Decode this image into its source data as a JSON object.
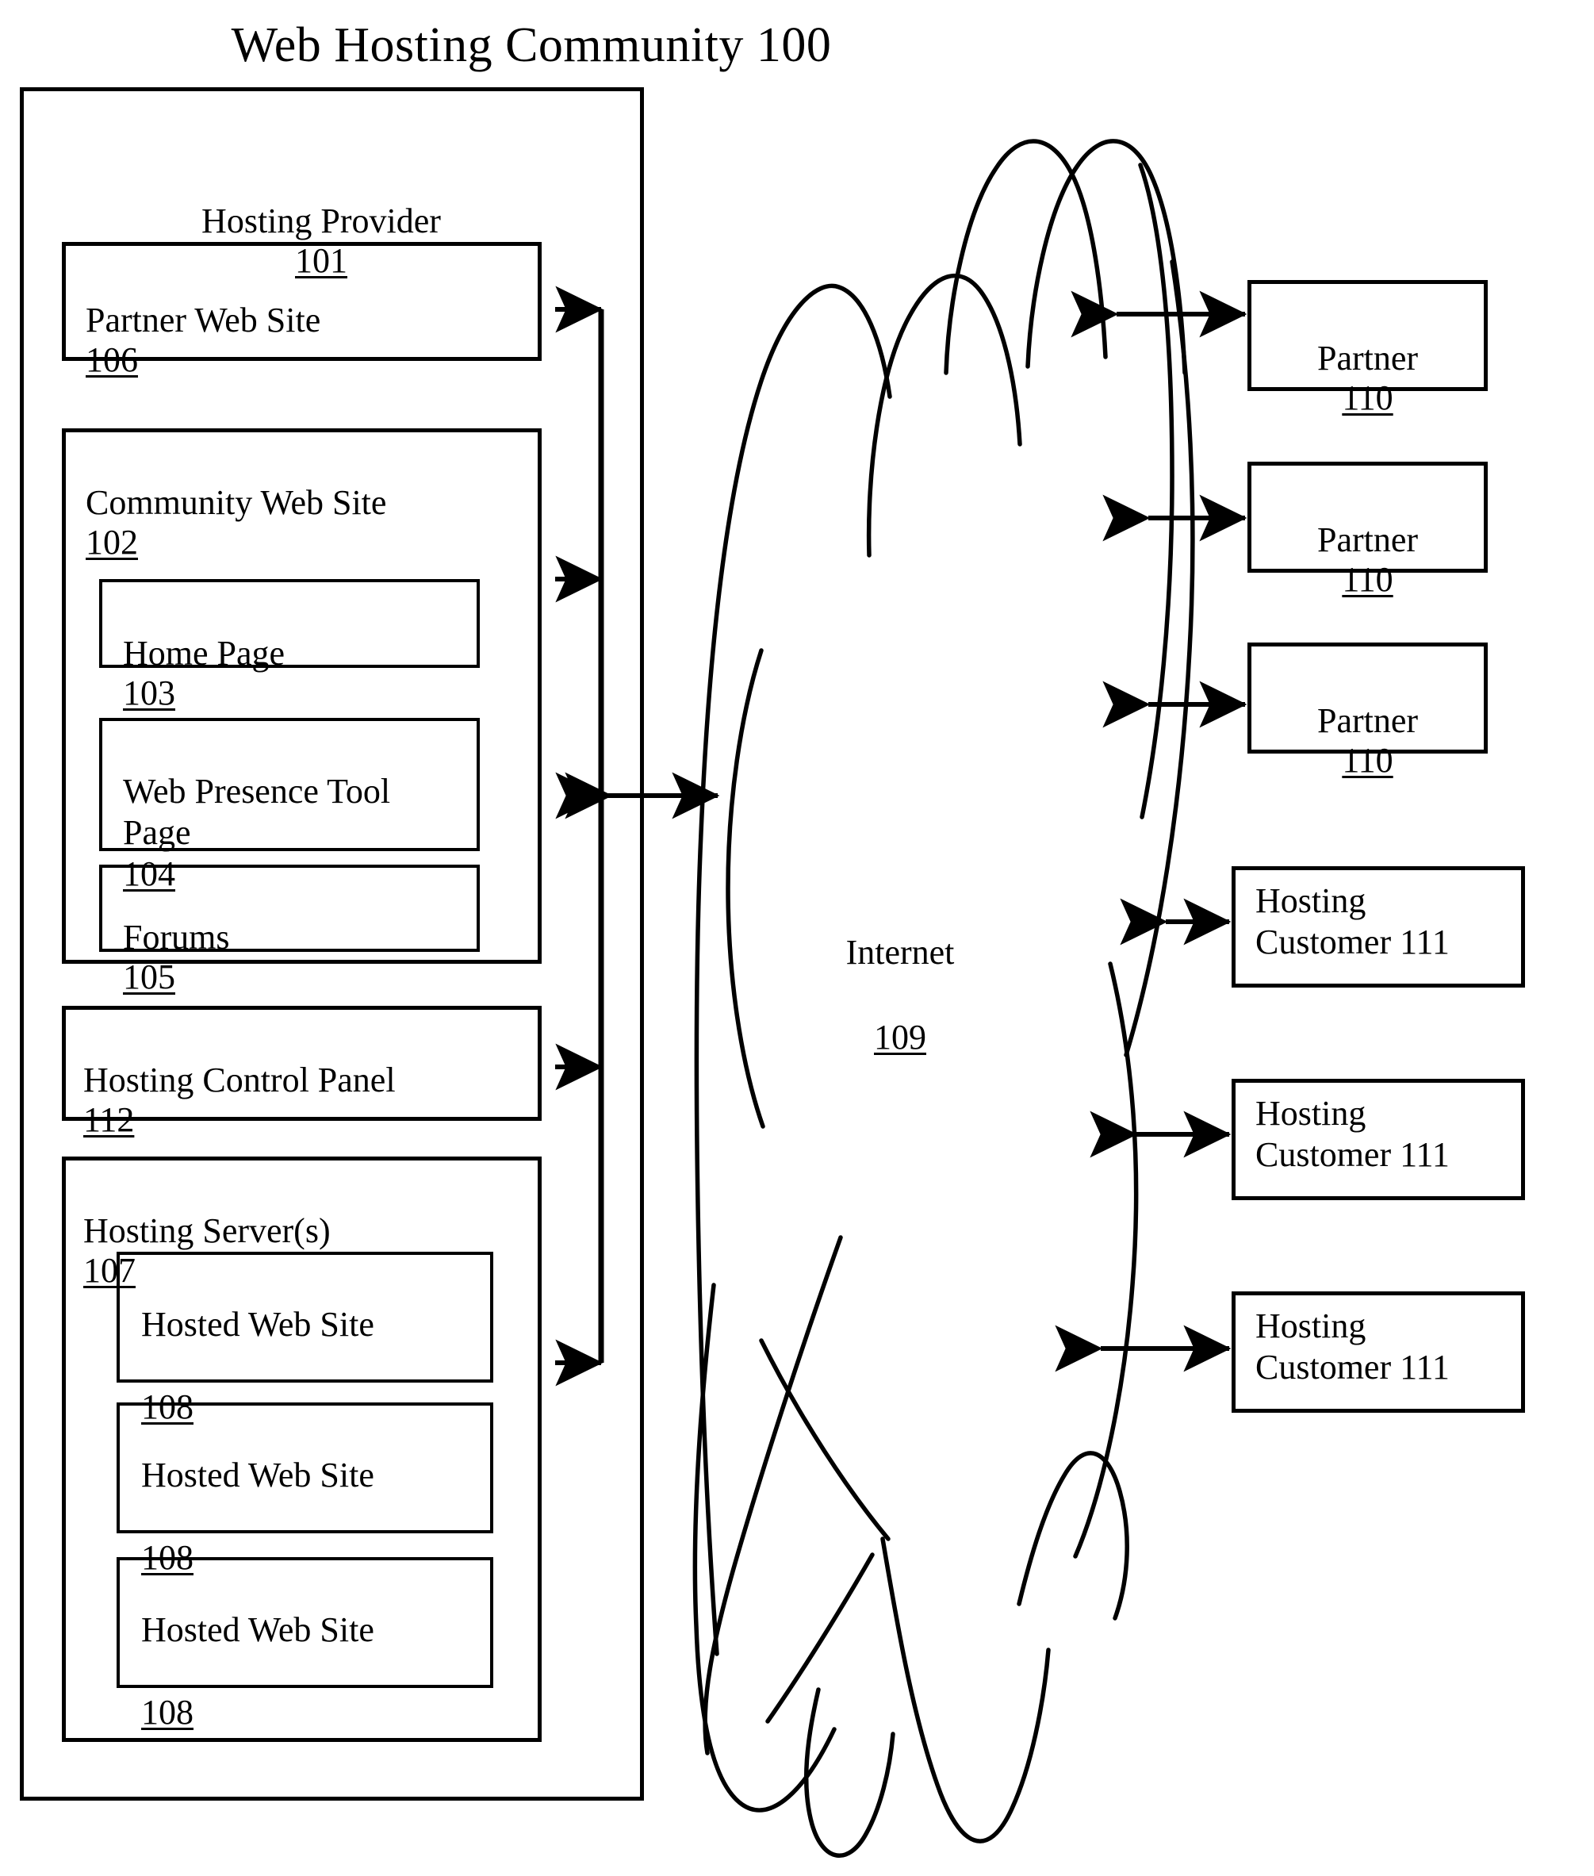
{
  "figure": {
    "title": "Web Hosting Community 100",
    "title_ref": "100"
  },
  "hosting_provider": {
    "label": "Hosting Provider",
    "ref": "101",
    "partner_web_site": {
      "label": "Partner Web Site",
      "ref": "106"
    },
    "hosting_control_panel": {
      "label": "Hosting Control Panel",
      "ref": "112"
    },
    "community_web_site": {
      "label": "Community Web Site",
      "ref": "102",
      "pages": [
        {
          "label": "Home Page",
          "ref": "103"
        },
        {
          "label": "Web Presence Tool Page",
          "ref": "104"
        },
        {
          "label": "Forums",
          "ref": "105"
        }
      ]
    },
    "hosting_servers": {
      "label": "Hosting Server(s)",
      "ref": "107",
      "sites": [
        {
          "label": "Hosted Web Site",
          "ref": "108"
        },
        {
          "label": "Hosted Web Site",
          "ref": "108"
        },
        {
          "label": "Hosted Web Site",
          "ref": "108"
        }
      ]
    }
  },
  "network": {
    "label": "Internet",
    "ref": "109"
  },
  "external_nodes": [
    {
      "label": "Partner",
      "ref": "110",
      "ref_underlined": true
    },
    {
      "label": "Partner",
      "ref": "110",
      "ref_underlined": true
    },
    {
      "label": "Partner",
      "ref": "110",
      "ref_underlined": true
    },
    {
      "label": "Hosting\nCustomer 111",
      "ref": "111",
      "ref_underlined": false
    },
    {
      "label": "Hosting\nCustomer 111",
      "ref": "111",
      "ref_underlined": false
    },
    {
      "label": "Hosting\nCustomer 111",
      "ref": "111",
      "ref_underlined": false
    }
  ],
  "colors": {
    "ink": "#000000",
    "paper": "#ffffff"
  }
}
